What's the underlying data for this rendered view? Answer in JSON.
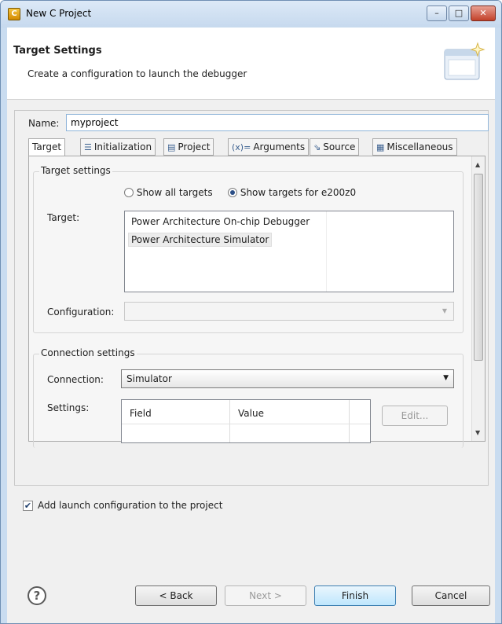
{
  "window": {
    "title": "New C Project",
    "controls": {
      "minimize": "–",
      "maximize": "□",
      "close": "✕"
    }
  },
  "header": {
    "title": "Target Settings",
    "description": "Create a configuration to launch the debugger",
    "icon": "wizard-banner-icon"
  },
  "name_field": {
    "label": "Name:",
    "value": "myproject"
  },
  "tabs": [
    {
      "label": "Target",
      "icon": ""
    },
    {
      "label": "Initialization",
      "icon": "list-icon"
    },
    {
      "label": "Project",
      "icon": "page-icon"
    },
    {
      "label": "Arguments",
      "icon": "arguments-icon"
    },
    {
      "label": "Source",
      "icon": "source-icon"
    },
    {
      "label": "Miscellaneous",
      "icon": "table-icon"
    }
  ],
  "target_settings": {
    "group_title": "Target settings",
    "radio_all": "Show all targets",
    "radio_filtered": "Show targets for e200z0",
    "selected_radio": "filtered",
    "target_label": "Target:",
    "targets": [
      "Power Architecture On-chip Debugger",
      "Power Architecture Simulator"
    ],
    "selected_target": "Power Architecture Simulator",
    "configuration_label": "Configuration:",
    "configuration_value": ""
  },
  "connection_settings": {
    "group_title": "Connection settings",
    "connection_label": "Connection:",
    "connection_value": "Simulator",
    "settings_label": "Settings:",
    "table_headers": [
      "Field",
      "Value"
    ],
    "edit_button": "Edit..."
  },
  "checkbox": {
    "label": "Add launch configuration to the project",
    "checked": true
  },
  "footer": {
    "help": "?",
    "back": "< Back",
    "next": "Next >",
    "finish": "Finish",
    "cancel": "Cancel"
  },
  "colors": {
    "accent": "#3c7fb1",
    "window_frame": "#c9dcf0"
  }
}
